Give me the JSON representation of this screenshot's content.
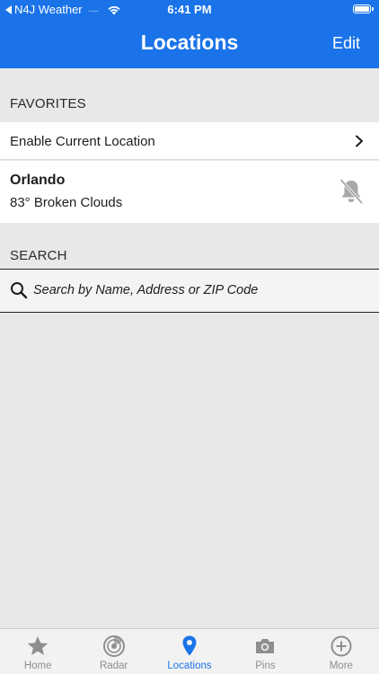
{
  "status_bar": {
    "carrier": "N4J Weather",
    "signal": "....",
    "time": "6:41 PM"
  },
  "nav": {
    "title": "Locations",
    "edit_label": "Edit"
  },
  "favorites": {
    "header": "FAVORITES",
    "enable_label": "Enable Current Location",
    "items": [
      {
        "name": "Orlando",
        "conditions": "83° Broken Clouds"
      }
    ]
  },
  "search": {
    "header": "SEARCH",
    "placeholder": "Search by Name, Address or ZIP Code"
  },
  "tabs": [
    {
      "label": "Home",
      "icon": "star-icon"
    },
    {
      "label": "Radar",
      "icon": "radar-icon"
    },
    {
      "label": "Locations",
      "icon": "location-pin-icon"
    },
    {
      "label": "Pins",
      "icon": "camera-icon"
    },
    {
      "label": "More",
      "icon": "plus-circle-icon"
    }
  ],
  "active_tab": "Locations",
  "colors": {
    "accent": "#1a73e8",
    "background": "#e8e8e8",
    "tab_inactive": "#8e8e8e"
  }
}
